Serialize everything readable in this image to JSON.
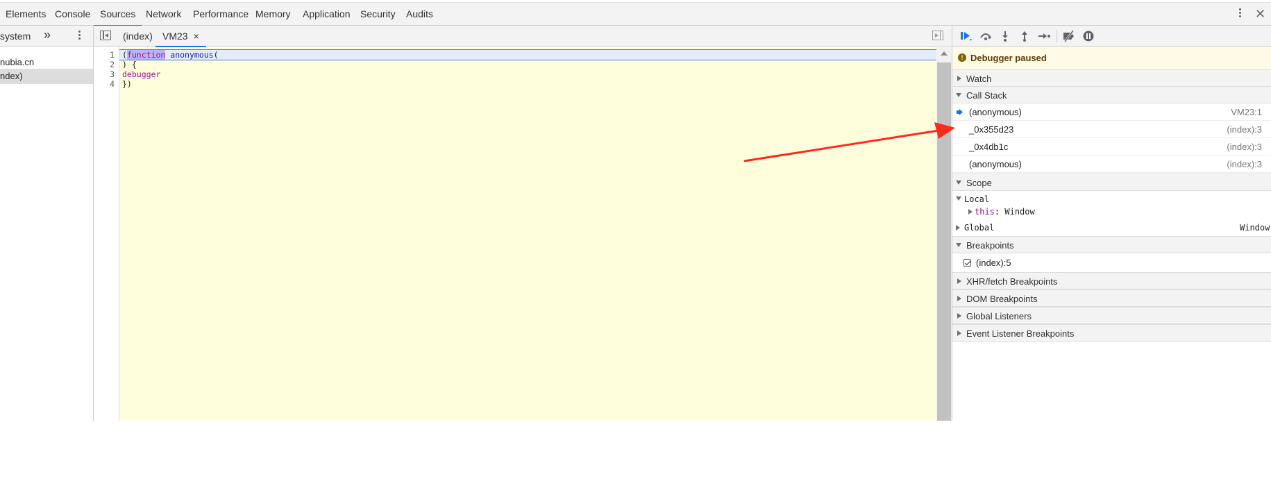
{
  "top_tabs": [
    "Elements",
    "Console",
    "Sources",
    "Network",
    "Performance",
    "Memory",
    "Application",
    "Security",
    "Audits"
  ],
  "active_top_tab": "Sources",
  "navigator": {
    "header_label": "system",
    "more_glyph": "»",
    "items": [
      "nubia.cn",
      "ndex)"
    ]
  },
  "editor": {
    "tabs": [
      {
        "label": "(index)",
        "closable": false
      },
      {
        "label": "VM23",
        "closable": true,
        "close_glyph": "×"
      }
    ],
    "active_tab": "VM23",
    "line_numbers": [
      "1",
      "2",
      "3",
      "4"
    ],
    "code": {
      "line1_open": "(",
      "line1_caret_char": "f",
      "line1_keyword_rest": "unction",
      "line1_space": " ",
      "line1_name": "anonymous",
      "line1_paren": "(",
      "line2": ") {",
      "line3": "debugger",
      "line4": "})"
    }
  },
  "debugger": {
    "toolbar_buttons": [
      "resume-icon",
      "step-over-icon",
      "step-into-icon",
      "step-out-icon",
      "step-icon",
      "deactivate-breakpoints-icon",
      "pause-on-exceptions-icon"
    ],
    "paused_banner": "Debugger paused",
    "paused_icon_glyph": "!",
    "sections": {
      "watch": "Watch",
      "call_stack": "Call Stack",
      "scope": "Scope",
      "breakpoints": "Breakpoints",
      "xhr": "XHR/fetch Breakpoints",
      "dom": "DOM Breakpoints",
      "global_listeners": "Global Listeners",
      "event_listeners": "Event Listener Breakpoints"
    },
    "call_stack": [
      {
        "name": "(anonymous)",
        "location": "VM23:1",
        "current": true
      },
      {
        "name": "_0x355d23",
        "location": "(index):3",
        "current": false
      },
      {
        "name": "_0x4db1c",
        "location": "(index):3",
        "current": false
      },
      {
        "name": "(anonymous)",
        "location": "(index):3",
        "current": false
      }
    ],
    "scope": {
      "local_label": "Local",
      "this_name": "this",
      "this_sep": ":",
      "this_value": "Window",
      "global_label": "Global",
      "global_value": "Window"
    },
    "breakpoints": [
      {
        "label": "(index):5",
        "checked": true
      }
    ]
  },
  "colors": {
    "accent": "#1a73e8",
    "annotation_arrow": "#ff2a1a",
    "paused_banner_bg": "#fffbe6",
    "code_bg": "#fffedc"
  }
}
